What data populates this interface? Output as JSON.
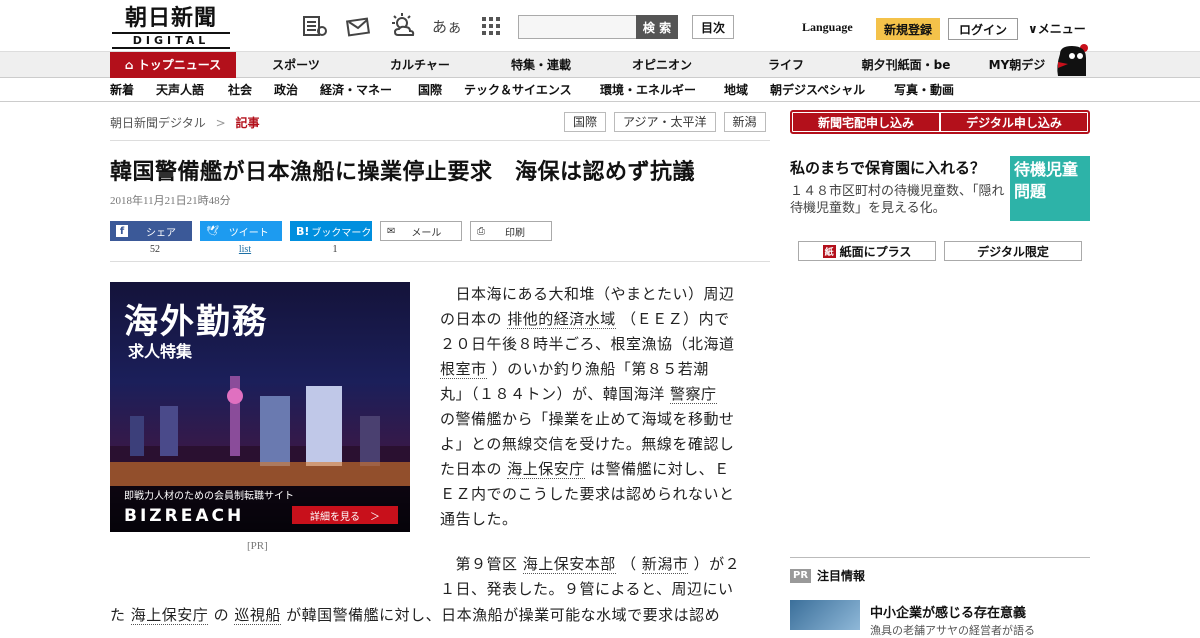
{
  "header": {
    "logo_jp": "朝日新聞",
    "logo_en": "DIGITAL",
    "search_button": "検 索",
    "search_placeholder": "",
    "mokuji": "目次",
    "language": "Language",
    "register": "新規登録",
    "login": "ログイン",
    "menu": "メニュー",
    "icons": [
      "newspaper-icon",
      "mail-icon",
      "weather-icon",
      "font-size-icon",
      "grid-icon"
    ],
    "font_icon_text": "あぁ"
  },
  "nav1": [
    "トップニュース",
    "スポーツ",
    "カルチャー",
    "特集・連載",
    "オピニオン",
    "ライフ",
    "朝夕刊紙面・be",
    "MY朝デジ"
  ],
  "nav2": [
    "新着",
    "天声人語",
    "社会",
    "政治",
    "経済・マネー",
    "国際",
    "テック＆サイエンス",
    "環境・エネルギー",
    "地域",
    "朝デジスペシャル",
    "写真・動画"
  ],
  "breadcrumb": {
    "home": "朝日新聞デジタル",
    "sep": ">",
    "current": "記事"
  },
  "tags": [
    "国際",
    "アジア・太平洋",
    "新潟"
  ],
  "article": {
    "title": "韓国警備艦が日本漁船に操業停止要求　海保は認めず抗議",
    "date": "2018年11月21日21時48分",
    "share": {
      "facebook": "シェア",
      "facebook_count": "52",
      "twitter": "ツイート",
      "twitter_count": "list",
      "hatena": "ブックマーク",
      "hatena_icon": "B!",
      "hatena_count": "1",
      "mail": "メール",
      "print": "印刷"
    },
    "p1": [
      "　日本海にある大和堆（やまとたい）周辺",
      [
        "の日本の ",
        "排他的経済水域",
        " （ＥＥＺ）内で"
      ],
      "２０日午後８時半ごろ、根室漁協（北海道",
      [
        "",
        "根室市",
        " ）のいか釣り漁船「第８５若潮"
      ],
      [
        "丸」（１８４トン）が、韓国海洋 ",
        "警察庁",
        ""
      ],
      "の警備艦から「操業を止めて海域を移動せ",
      "よ」との無線交信を受けた。無線を確認し",
      [
        "た日本の ",
        "海上保安庁",
        " は警備艦に対し、Ｅ"
      ],
      "ＥＺ内でのこうした要求は認められないと",
      "通告した。"
    ],
    "p2": [
      [
        "　第９管区 ",
        "海上保安本部",
        " （ ",
        "新潟市",
        " ）が２"
      ],
      "１日、発表した。９管によると、周辺にい"
    ],
    "p3": [
      "た ",
      "海上保安庁",
      " の ",
      "巡視船",
      " が韓国警備艦に対し、日本漁船が操業可能な水域で要求は認め"
    ]
  },
  "ad": {
    "headline": "海外勤務",
    "subhead": "求人特集",
    "tagline": "即戦力人材のための会員制転職サイト",
    "brand": "BIZREACH",
    "button": "詳細を見る　＞",
    "pr_label": "[PR]"
  },
  "sidebar": {
    "subscribe_paper": "新聞宅配申し込み",
    "subscribe_digital": "デジタル申し込み",
    "promo_title": "私のまちで保育園に入れる？",
    "promo_desc": "１４８市区町村の待機児童数、「隠れ待機児童数」を見える化。",
    "promo_image_text": "待機児童問題",
    "paper_plus": "紙面にプラス",
    "paper_plus_icon": "紙",
    "digital_only": "デジタル限定",
    "chui_badge": "PR",
    "chui_label": "注目情報",
    "chui_title": "中小企業が感じる存在意義",
    "chui_desc": "漁具の老舗アサヤの経営者が語る"
  },
  "colors": {
    "brand_red": "#b3101b",
    "register_yellow": "#f4c24a"
  }
}
